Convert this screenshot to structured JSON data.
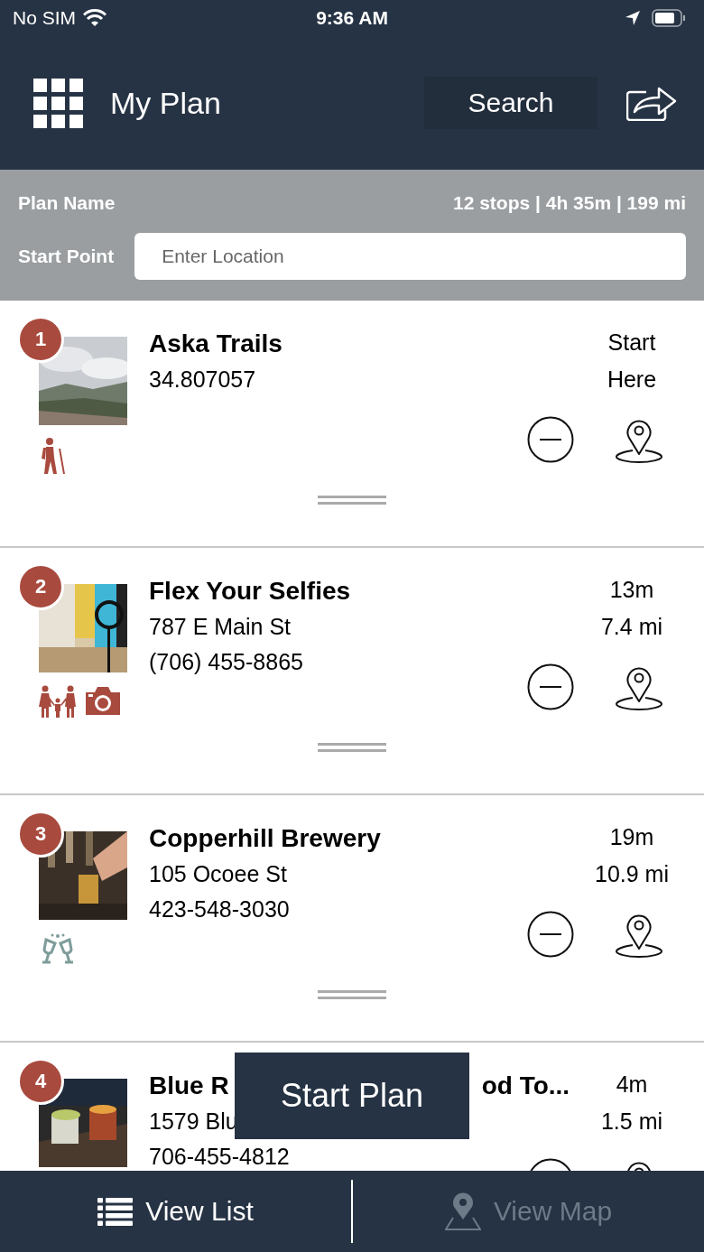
{
  "status_bar": {
    "carrier": "No SIM",
    "time": "9:36 AM"
  },
  "header": {
    "title": "My Plan",
    "search_button": "Search"
  },
  "plan": {
    "name_label": "Plan Name",
    "summary": "12 stops | 4h 35m | 199 mi",
    "start_label": "Start Point",
    "start_field": {
      "placeholder": "Enter Location"
    }
  },
  "stops": [
    {
      "number": "1",
      "title": "Aska Trails",
      "lines": [
        "34.807057"
      ],
      "times": [
        "Start",
        "Here"
      ],
      "categories": [
        {
          "kind": "hiking"
        }
      ]
    },
    {
      "number": "2",
      "title": "Flex Your Selfies",
      "lines": [
        "787 E Main St",
        "(706) 455-8865"
      ],
      "times": [
        "13m",
        "7.4 mi"
      ],
      "categories": [
        {
          "kind": "family"
        },
        {
          "kind": "camera"
        }
      ]
    },
    {
      "number": "3",
      "title": "Copperhill Brewery",
      "lines": [
        "105 Ocoee St",
        "423-548-3030"
      ],
      "times": [
        "19m",
        "10.9 mi"
      ],
      "categories": [
        {
          "kind": "drinks"
        }
      ]
    },
    {
      "number": "4",
      "title_parts": [
        "Blue R",
        "od To..."
      ],
      "lines": [
        "1579 Blu",
        "706-455-4812"
      ],
      "times": [
        "4m",
        "1.5 mi"
      ]
    }
  ],
  "start_plan_button": "Start Plan",
  "tabs": [
    {
      "label": "View List",
      "selected": true,
      "kind": "list"
    },
    {
      "label": "View Map",
      "selected": false,
      "kind": "map"
    }
  ]
}
